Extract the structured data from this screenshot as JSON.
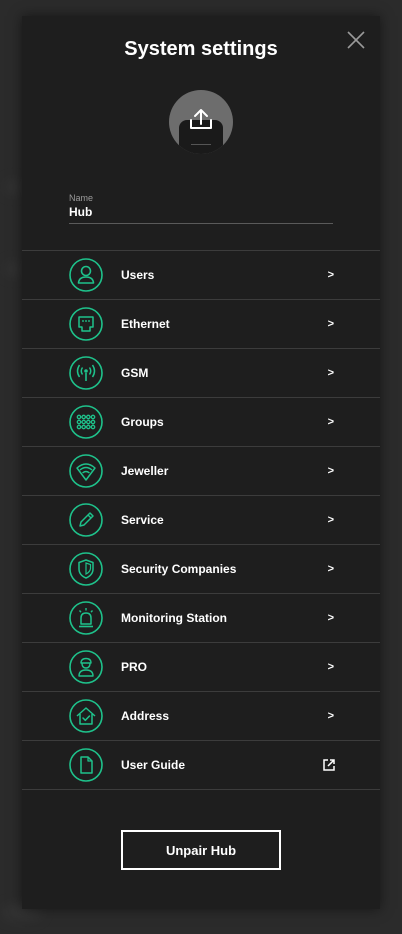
{
  "title": "System settings",
  "name_field": {
    "label": "Name",
    "value": "Hub"
  },
  "accent_color": "#1ec28b",
  "menu": {
    "arrow": ">",
    "items": [
      {
        "label": "Users",
        "icon": "user-icon"
      },
      {
        "label": "Ethernet",
        "icon": "ethernet-port-icon"
      },
      {
        "label": "GSM",
        "icon": "antenna-icon"
      },
      {
        "label": "Groups",
        "icon": "grid-dots-icon"
      },
      {
        "label": "Jeweller",
        "icon": "wifi-shield-icon"
      },
      {
        "label": "Service",
        "icon": "pencil-icon"
      },
      {
        "label": "Security Companies",
        "icon": "shield-icon"
      },
      {
        "label": "Monitoring Station",
        "icon": "siren-icon"
      },
      {
        "label": "PRO",
        "icon": "worker-icon"
      },
      {
        "label": "Address",
        "icon": "home-check-icon"
      },
      {
        "label": "User Guide",
        "icon": "document-icon"
      }
    ]
  },
  "unpair_label": "Unpair Hub"
}
